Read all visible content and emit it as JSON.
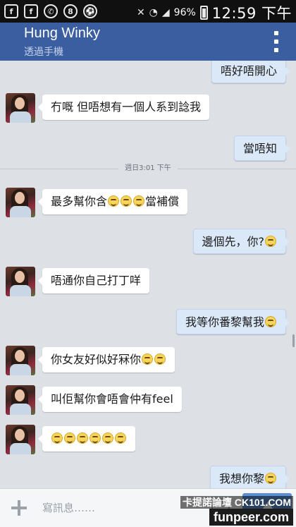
{
  "status_bar": {
    "battery_percent": "96%",
    "time": "12:59 下午",
    "left_icons": [
      "facebook-icon",
      "facebook-icon",
      "whatsapp-icon",
      "messenger-icon",
      "soccer-icon"
    ],
    "right_icons": [
      "mute-icon",
      "wifi-icon",
      "signal-icon",
      "battery-icon"
    ]
  },
  "header": {
    "contact_name": "Hung Winky",
    "subtitle": "透過手機",
    "menu_icon": "overflow-menu-icon",
    "color": "#3b5ea0"
  },
  "messages": [
    {
      "direction": "out",
      "text": "唔好唔開心",
      "smileys": 0
    },
    {
      "direction": "in",
      "text": "冇嘅 但唔想有一個人系到諗我",
      "smileys": 0
    },
    {
      "direction": "out",
      "text": "當唔知",
      "smileys": 0
    },
    {
      "direction": "in",
      "text": "最多幫你含",
      "smileys": 3,
      "text_after": "當補償"
    },
    {
      "direction": "out",
      "text": "邊個先，你?",
      "smileys": 1
    },
    {
      "direction": "in",
      "text": "唔通你自己打丁咩",
      "smileys": 0
    },
    {
      "direction": "out",
      "text": "我等你番黎幫我",
      "smileys": 1
    },
    {
      "direction": "in",
      "text": "你女友好似好冧你",
      "smileys": 2
    },
    {
      "direction": "in",
      "text": "叫佢幫你會唔會仲有feel",
      "smileys": 0
    },
    {
      "direction": "in",
      "text": "",
      "smileys": 6
    },
    {
      "direction": "out",
      "text": "我想你黎",
      "smileys": 1
    }
  ],
  "timestamp": "週日3:01 下午",
  "composer": {
    "placeholder": "寫訊息……",
    "add_icon": "plus-icon",
    "emoji_icon": "emoji-icon",
    "send_icon": "send-icon",
    "send_color": "#5b8ed2"
  },
  "watermark": {
    "line1": "卡提諾論壇 CK101.COM",
    "line2": "funpeer.com"
  },
  "colors": {
    "background": "#dde1e6",
    "incoming_bubble": "#ffffff",
    "outgoing_bubble": "#dbe8f8"
  }
}
